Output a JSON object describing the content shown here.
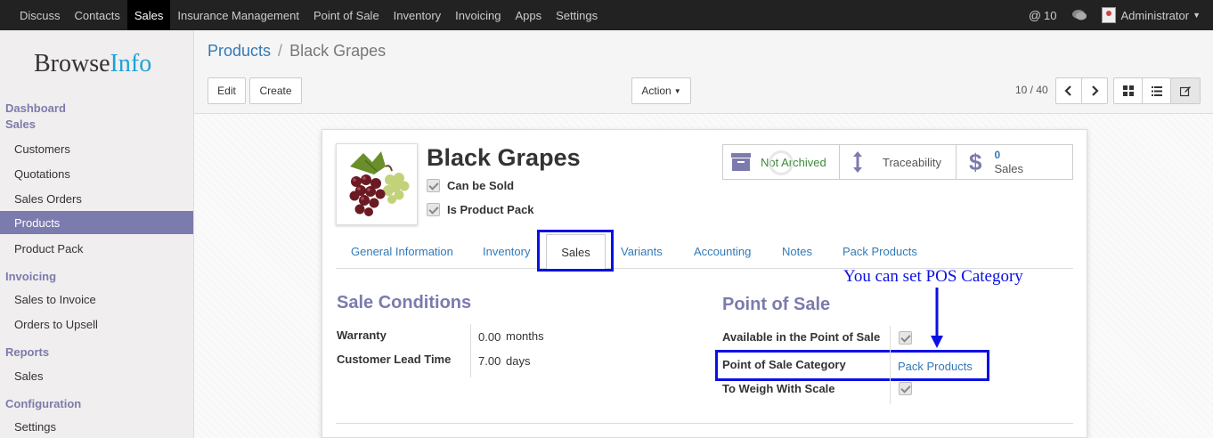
{
  "topbar": {
    "menu": [
      "Discuss",
      "Contacts",
      "Sales",
      "Insurance Management",
      "Point of Sale",
      "Inventory",
      "Invoicing",
      "Apps",
      "Settings"
    ],
    "active": "Sales",
    "messages_count": "10",
    "user": "Administrator"
  },
  "sidebar": {
    "logo_browse": "Browse",
    "logo_info": "Info",
    "dashboard": "Dashboard",
    "sales_head": "Sales",
    "customers": "Customers",
    "quotations": "Quotations",
    "sales_orders": "Sales Orders",
    "products": "Products",
    "product_pack": "Product Pack",
    "invoicing_head": "Invoicing",
    "sales_to_invoice": "Sales to Invoice",
    "orders_to_upsell": "Orders to Upsell",
    "reports_head": "Reports",
    "reports_sales": "Sales",
    "configuration_head": "Configuration",
    "settings": "Settings"
  },
  "breadcrumb": {
    "parent": "Products",
    "separator": "/",
    "current": "Black Grapes"
  },
  "toolbar": {
    "edit": "Edit",
    "create": "Create",
    "action": "Action",
    "pager": "10 / 40"
  },
  "product": {
    "name": "Black Grapes",
    "can_be_sold": "Can be Sold",
    "is_product_pack": "Is Product Pack"
  },
  "smart_buttons": {
    "archive": "Not Archived",
    "traceability": "Traceability",
    "sales_count": "0",
    "sales_label": "Sales"
  },
  "tabs": [
    "General Information",
    "Inventory",
    "Sales",
    "Variants",
    "Accounting",
    "Notes",
    "Pack Products"
  ],
  "active_tab": "Sales",
  "annotation": "You can set POS Category",
  "sale_conditions": {
    "title": "Sale Conditions",
    "warranty_label": "Warranty",
    "warranty_value": "0.00",
    "warranty_unit": "months",
    "lead_time_label": "Customer Lead Time",
    "lead_time_value": "7.00",
    "lead_time_unit": "days"
  },
  "point_of_sale": {
    "title": "Point of Sale",
    "available_label": "Available in the Point of Sale",
    "category_label": "Point of Sale Category",
    "category_value": "Pack Products",
    "weigh_label": "To Weigh With Scale"
  },
  "colors": {
    "accent": "#7c7bad",
    "link": "#337ab7",
    "annotation": "#0a10e6"
  }
}
